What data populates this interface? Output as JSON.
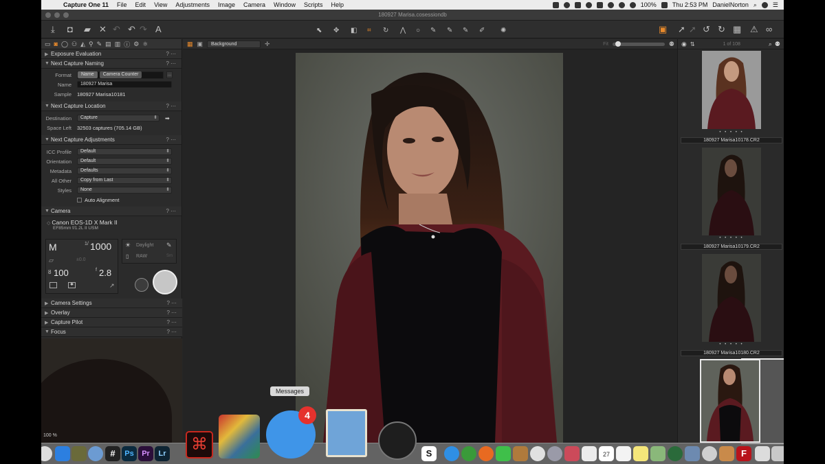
{
  "menubar": {
    "app_name": "Capture One 11",
    "items": [
      "File",
      "Edit",
      "View",
      "Adjustments",
      "Image",
      "Camera",
      "Window",
      "Scripts",
      "Help"
    ],
    "battery": "100%",
    "clock": "Thu 2:53 PM",
    "user": "DanielNorton"
  },
  "window": {
    "title": "180927 Marisa.cosessiondb"
  },
  "left_panel": {
    "sections": {
      "exposure_evaluation": "Exposure Evaluation",
      "next_capture_naming": "Next Capture Naming",
      "next_capture_location": "Next Capture Location",
      "next_capture_adjustments": "Next Capture Adjustments",
      "camera": "Camera",
      "camera_settings": "Camera Settings",
      "overlay": "Overlay",
      "capture_pilot": "Capture Pilot",
      "focus": "Focus"
    },
    "naming": {
      "format_label": "Format",
      "format_tokens": [
        "Name",
        "Camera Counter"
      ],
      "name_label": "Name",
      "name_value": "180927 Marisa",
      "sample_label": "Sample",
      "sample_value": "180927 Marisa10181"
    },
    "location": {
      "destination_label": "Destination",
      "destination_value": "Capture",
      "space_label": "Space Left",
      "space_value": "32503 captures (705.14 GB)"
    },
    "adjustments": {
      "icc_label": "ICC Profile",
      "icc_value": "Default",
      "orientation_label": "Orientation",
      "orientation_value": "Default",
      "metadata_label": "Metadata",
      "metadata_value": "Defaults",
      "allother_label": "All Other",
      "allother_value": "Copy from Last",
      "styles_label": "Styles",
      "styles_value": "None",
      "auto_alignment": "Auto Alignment"
    },
    "camera": {
      "model": "Canon EOS-1D X Mark II",
      "lens": "EF85mm f/1.2L II USM",
      "mode": "M",
      "shutter_prefix": "1/",
      "shutter": "1000",
      "exposure_comp": "±0.0",
      "iso": "100",
      "aperture_prefix": "f",
      "aperture": "2.8",
      "wb": "Daylight",
      "file_format": "RAW",
      "sm": "Sm"
    },
    "zoom": "100 %"
  },
  "viewer": {
    "background_select": "Background",
    "fit_label": "Fit"
  },
  "browser": {
    "count": "1 of 108",
    "thumbs": [
      {
        "label": "180927 Marisa10178.CR2",
        "rating": "• • • • •"
      },
      {
        "label": "180927 Marisa10179.CR2",
        "rating": "• • • • •"
      },
      {
        "label": "180927 Marisa10180.CR2",
        "rating": "• • • • •"
      },
      {
        "label": "180927 Marisa10181.CR2",
        "rating": ""
      }
    ]
  },
  "dock": {
    "tooltip": "Messages",
    "messages_badge": "4"
  },
  "colors": {
    "accent": "#e88a2c",
    "panel": "#2b2b2b",
    "sweater": "#5a1a20"
  }
}
